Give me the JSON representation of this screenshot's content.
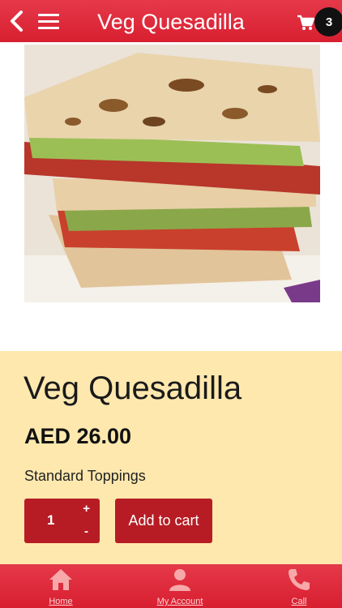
{
  "header": {
    "title": "Veg Quesadilla",
    "cart_count": "3",
    "back_icon": "chevron-left-icon",
    "menu_icon": "hamburger-menu-icon",
    "cart_icon": "shopping-cart-icon"
  },
  "product": {
    "name": "Veg Quesadilla",
    "price": "AED 26.00",
    "option": "Standard Toppings",
    "quantity": "1",
    "plus": "+",
    "minus": "-",
    "add_to_cart": "Add to cart"
  },
  "footer": {
    "items": [
      {
        "label": "Home",
        "icon": "home-icon"
      },
      {
        "label": "My Account",
        "icon": "user-icon"
      },
      {
        "label": "Call",
        "icon": "phone-icon"
      }
    ]
  },
  "colors": {
    "header": "#dc2a3b",
    "panel": "#fee8ae",
    "button": "#b71c24",
    "badge": "#111111"
  }
}
